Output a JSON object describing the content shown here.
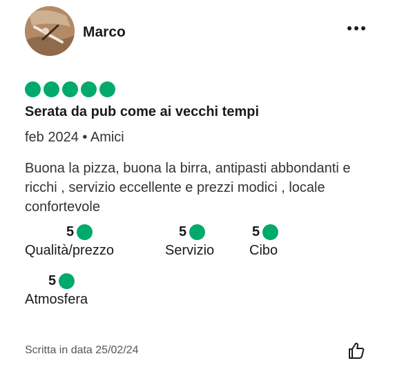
{
  "review": {
    "author": "Marco",
    "bubble_rating": 5,
    "title": "Serata da pub come ai vecchi tempi",
    "meta": "feb 2024 • Amici",
    "text": "Buona la pizza, buona la birra, antipasti abbondanti e ricchi , servizio eccellente e prezzi modici , locale confortevole",
    "subratings": [
      {
        "value": "5",
        "label": "Qualità/prezzo"
      },
      {
        "value": "5",
        "label": "Servizio"
      },
      {
        "value": "5",
        "label": "Cibo"
      },
      {
        "value": "5",
        "label": "Atmosfera"
      }
    ],
    "written_date": "Scritta in data 25/02/24"
  },
  "colors": {
    "bubble": "#00aa6c",
    "text": "#1a1a1a"
  },
  "icons": {
    "more": "more-options-icon",
    "helpful": "thumbs-up-icon"
  }
}
